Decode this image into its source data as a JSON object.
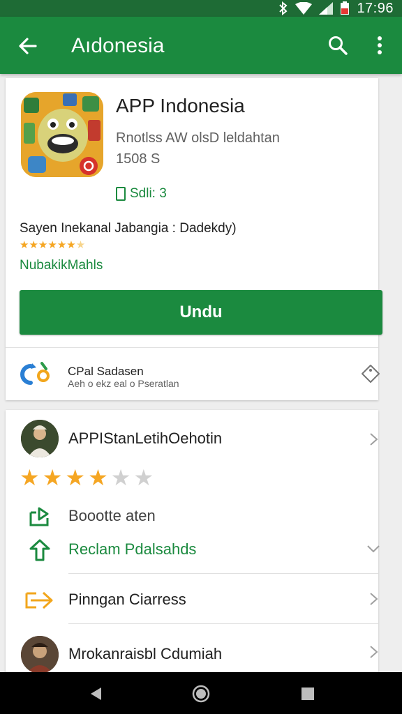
{
  "status_bar": {
    "time": "17:96",
    "icons": [
      "bluetooth-icon",
      "wifi-icon",
      "signal-icon",
      "battery-icon"
    ]
  },
  "app_bar": {
    "title": "Aıdonesia",
    "back_icon": "arrow-back-icon",
    "search_icon": "search-icon",
    "more_icon": "more-vert-icon"
  },
  "app": {
    "name": "APP Indonesia",
    "developer": "Rnotlss AW olsD leldahtan",
    "size": "1508 S",
    "install_note": "Sdli: 3",
    "description": "Sayen Inekanal Jabangia : Dadekdy)",
    "rating_stars": 6.5,
    "rating_max": 7,
    "category": "NubakikMahls",
    "install_label": "Undu",
    "colors": {
      "accent": "#1b8a3f",
      "star": "#f5a623"
    }
  },
  "share": {
    "title": "CPal Sadasen",
    "subtitle": "Aeh o ekz eal o Pseratlan",
    "logo_icon": "share-logo-icon",
    "tag_icon": "tag-icon"
  },
  "details": {
    "author_name": "APPIStanLetihOehotin",
    "rating": 4,
    "rating_max": 6,
    "rows": [
      {
        "label": "Boootte aten",
        "icon": "export-icon"
      },
      {
        "label": "Reclam Pdalsahds",
        "icon": "upload-icon"
      },
      {
        "label": "Pinngan Ciarress",
        "icon": "login-arrow-icon"
      },
      {
        "label": "Mrokanraisbl Cdumiah",
        "icon": "avatar"
      }
    ]
  }
}
